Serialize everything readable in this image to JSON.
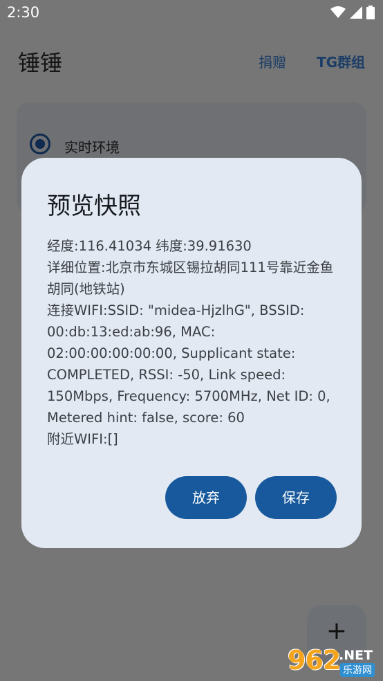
{
  "status_bar": {
    "time": "2:30"
  },
  "app": {
    "title": "锤锤",
    "actions": {
      "donate": "捐赠",
      "tg_group": "TG群组"
    },
    "environment": {
      "label": "实时环境",
      "selected": true
    },
    "fab_symbol": "+"
  },
  "dialog": {
    "title": "预览快照",
    "lines": {
      "coords": "经度:116.41034 纬度:39.91630",
      "location": "详细位置:北京市东城区锡拉胡同111号靠近金鱼胡同(地铁站)",
      "wifi": "连接WIFI:SSID: \"midea-HjzlhG\", BSSID: 00:db:13:ed:ab:96, MAC: 02:00:00:00:00:00, Supplicant state: COMPLETED, RSSI: -50, Link speed: 150Mbps, Frequency: 5700MHz, Net ID: 0, Metered hint: false, score: 60",
      "nearby": "附近WIFI:[]"
    },
    "buttons": {
      "discard": "放弃",
      "save": "保存"
    }
  },
  "watermark": {
    "number": "962",
    "net": ".NET",
    "cn": "乐游网"
  },
  "colors": {
    "accent": "#17599c",
    "dialog_bg": "#e2e9f3",
    "scrim": "#767676"
  }
}
